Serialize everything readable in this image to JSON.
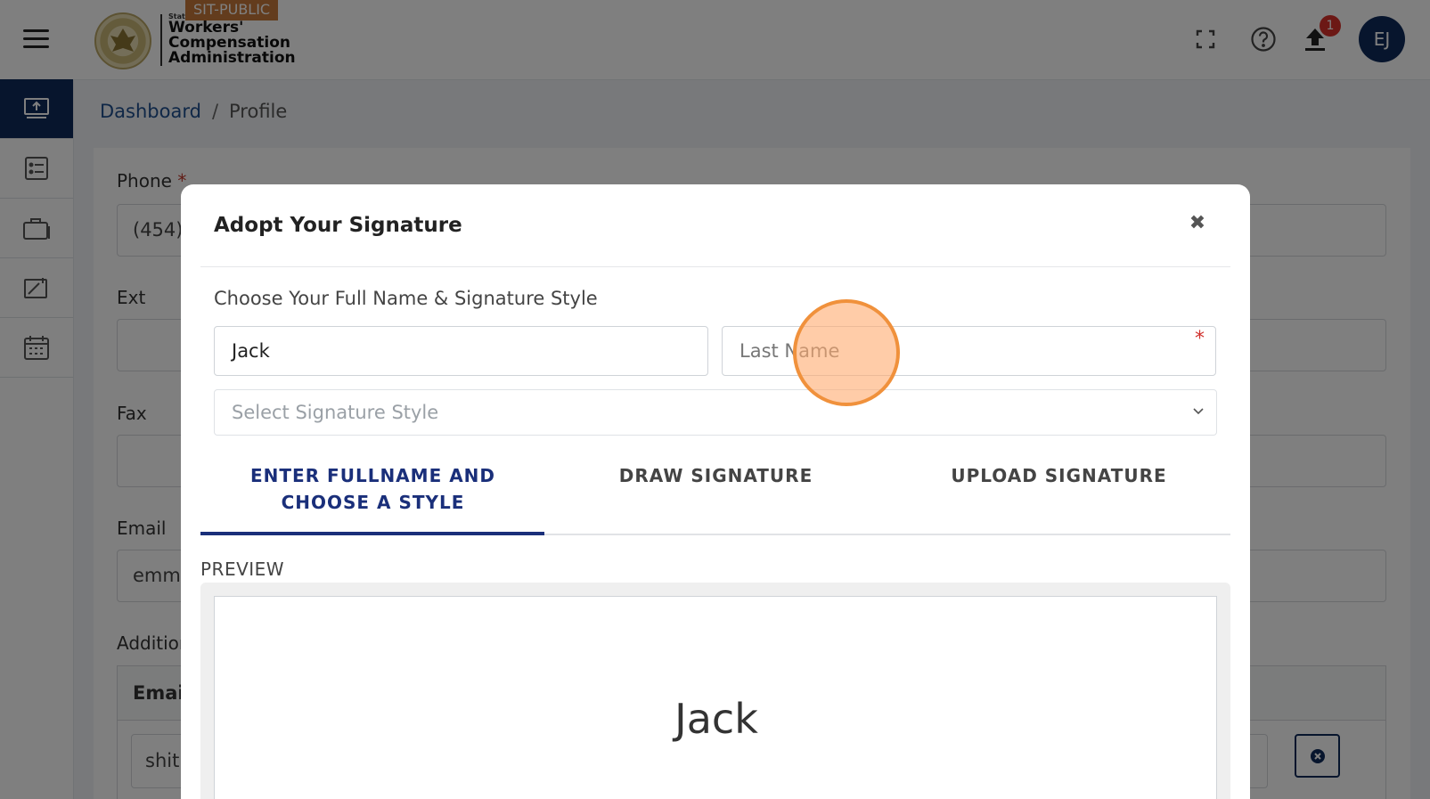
{
  "header": {
    "env_badge": "SIT-PUBLIC",
    "logo_state": "State",
    "logo_line1": "Workers'",
    "logo_line2": "Compensation",
    "logo_line3": "Administration",
    "notification_count": "1",
    "user_initials": "EJ"
  },
  "sidebar": {
    "items": [
      {
        "icon": "dashboard-monitor-icon",
        "active": true
      },
      {
        "icon": "checklist-icon",
        "active": false
      },
      {
        "icon": "briefcase-icon",
        "active": false
      },
      {
        "icon": "document-pen-icon",
        "active": false
      },
      {
        "icon": "calendar-icon",
        "active": false
      }
    ]
  },
  "breadcrumb": {
    "home": "Dashboard",
    "separator": "/",
    "current": "Profile"
  },
  "profile_form": {
    "phone_label": "Phone",
    "phone_required": "*",
    "phone_value": "(454)",
    "ext_label": "Ext",
    "fax_label": "Fax",
    "email_label": "Email",
    "email_value": "emm",
    "additional_label": "Addition",
    "table_header": "Emai",
    "row_value": "shit"
  },
  "modal": {
    "title": "Adopt Your Signature",
    "close": "✖",
    "subtitle": "Choose Your Full Name & Signature Style",
    "first_name_value": "Jack",
    "last_name_placeholder": "Last Name",
    "required_star": "*",
    "style_placeholder": "Select Signature Style",
    "tabs": [
      {
        "line1": "ENTER FULLNAME AND",
        "line2": "CHOOSE A STYLE",
        "active": true
      },
      {
        "line1": "DRAW SIGNATURE",
        "line2": "",
        "active": false
      },
      {
        "line1": "UPLOAD SIGNATURE",
        "line2": "",
        "active": false
      }
    ],
    "preview_label": "PREVIEW",
    "preview_text": "Jack"
  },
  "colors": {
    "navy": "#0f2a5b",
    "tab_active": "#1a2f7a",
    "badge_orange": "#c6793a",
    "notification_red": "#d9302a",
    "required_red": "#d0312d"
  }
}
